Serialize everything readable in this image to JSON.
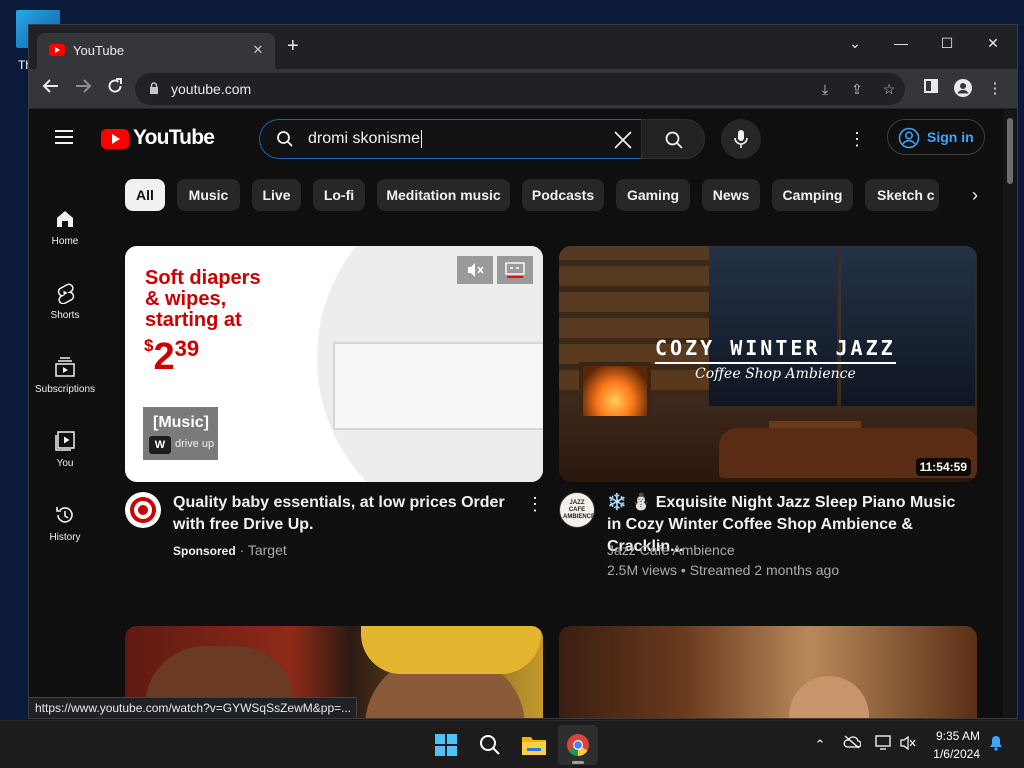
{
  "desktop": {
    "icon_label": "Th"
  },
  "browser": {
    "tab_title": "YouTube",
    "tab_close": "✕",
    "new_tab": "+",
    "url": "youtube.com",
    "window_controls": {
      "chevron": "⌄",
      "minimize": "—",
      "maximize": "☐",
      "close": "✕"
    },
    "status_url": "https://www.youtube.com/watch?v=GYWSqSsZewM&pp=..."
  },
  "youtube": {
    "logo_text": "YouTube",
    "search": {
      "value": "dromi skonisme"
    },
    "sign_in_label": "Sign in",
    "guide": [
      {
        "label": "Home"
      },
      {
        "label": "Shorts"
      },
      {
        "label": "Subscriptions"
      },
      {
        "label": "You"
      },
      {
        "label": "History"
      }
    ],
    "chips": [
      "All",
      "Music",
      "Live",
      "Lo-fi",
      "Meditation music",
      "Podcasts",
      "Gaming",
      "News",
      "Camping",
      "Sketch c"
    ],
    "ad": {
      "headline_line1": "Soft diapers",
      "headline_line2": "& wipes,",
      "headline_line3": "starting at",
      "price_dollar": "$",
      "price_main": "2",
      "price_cents": "39",
      "tag_music": "[Music]",
      "tag_w": "W",
      "tag_sub": "drive up",
      "title": "Quality baby essentials, at low prices Order with free Drive Up.",
      "sponsored": "Sponsored",
      "advertiser": "· Target"
    },
    "video": {
      "thumb_title": "COZY WINTER JAZZ",
      "thumb_subtitle": "Coffee Shop Ambience",
      "duration": "11:54:59",
      "title": "❄️ ⛄ Exquisite Night Jazz Sleep Piano Music in Cozy Winter Coffee Shop Ambience & Cracklin...",
      "channel": "Jazz Cafe Ambience",
      "meta": "2.5M views • Streamed 2 months ago",
      "avatar_text": "JAZZ CAFE AMBIENCE"
    }
  },
  "taskbar": {
    "time": "9:35 AM",
    "date": "1/6/2024"
  },
  "colors": {
    "yt_red": "#ff0000",
    "link_blue": "#3ea6ff",
    "target_red": "#cc0000"
  }
}
